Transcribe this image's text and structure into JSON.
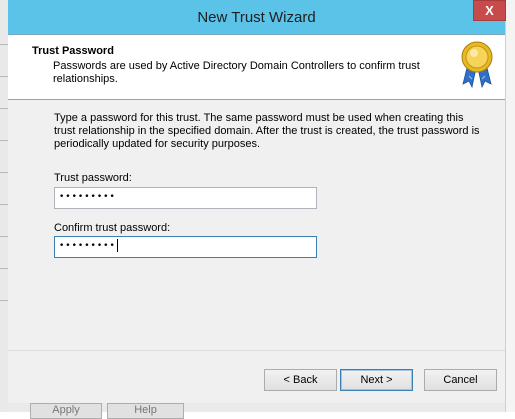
{
  "window": {
    "title": "New Trust Wizard",
    "close_glyph": "X"
  },
  "header": {
    "title": "Trust Password",
    "description": "Passwords are used by Active Directory Domain Controllers to confirm trust relationships.",
    "icon": "award-ribbon-icon"
  },
  "content": {
    "intro": "Type a password for this trust. The same password must be used when creating this trust relationship in the specified domain. After the trust is created, the trust password is periodically updated for security purposes.",
    "trust_password": {
      "label": "Trust password:",
      "value": "•••••••••"
    },
    "confirm_password": {
      "label": "Confirm trust password:",
      "value": "•••••••••"
    }
  },
  "buttons": {
    "back": "< Back",
    "next": "Next >",
    "cancel": "Cancel"
  },
  "background": {
    "apply": "Apply",
    "help": "Help"
  },
  "colors": {
    "frame": "#5bc3e8",
    "close": "#c74b4b",
    "focus_border": "#3c7fb1"
  }
}
